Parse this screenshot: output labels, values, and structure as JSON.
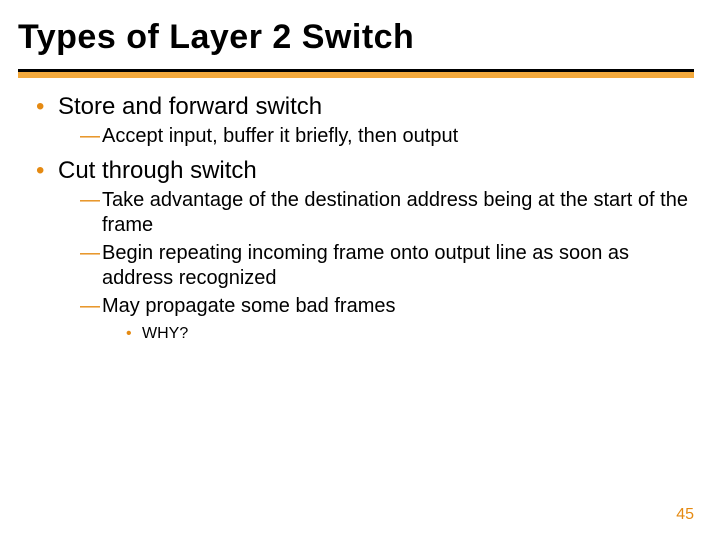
{
  "title": "Types of Layer 2 Switch",
  "page_number": "45",
  "bullets": [
    {
      "text": "Store and forward switch",
      "sub": [
        {
          "text": "Accept input, buffer it briefly, then output"
        }
      ]
    },
    {
      "text": "Cut through switch",
      "sub": [
        {
          "text": "Take advantage of the destination address being at the start of the frame"
        },
        {
          "text": "Begin repeating incoming frame onto output line as soon as address recognized"
        },
        {
          "text": "May propagate some bad frames",
          "sub": [
            {
              "text": "WHY?"
            }
          ]
        }
      ]
    }
  ]
}
